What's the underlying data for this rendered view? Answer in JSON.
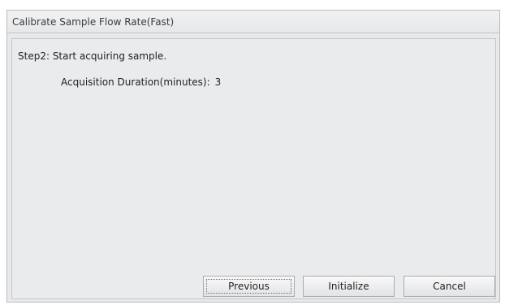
{
  "dialog": {
    "title": "Calibrate Sample Flow Rate(Fast)",
    "step_text": "Step2: Start acquiring sample.",
    "field": {
      "label": "Acquisition Duration(minutes):",
      "value": "3"
    },
    "buttons": {
      "previous": "Previous",
      "initialize": "Initialize",
      "cancel": "Cancel"
    }
  }
}
